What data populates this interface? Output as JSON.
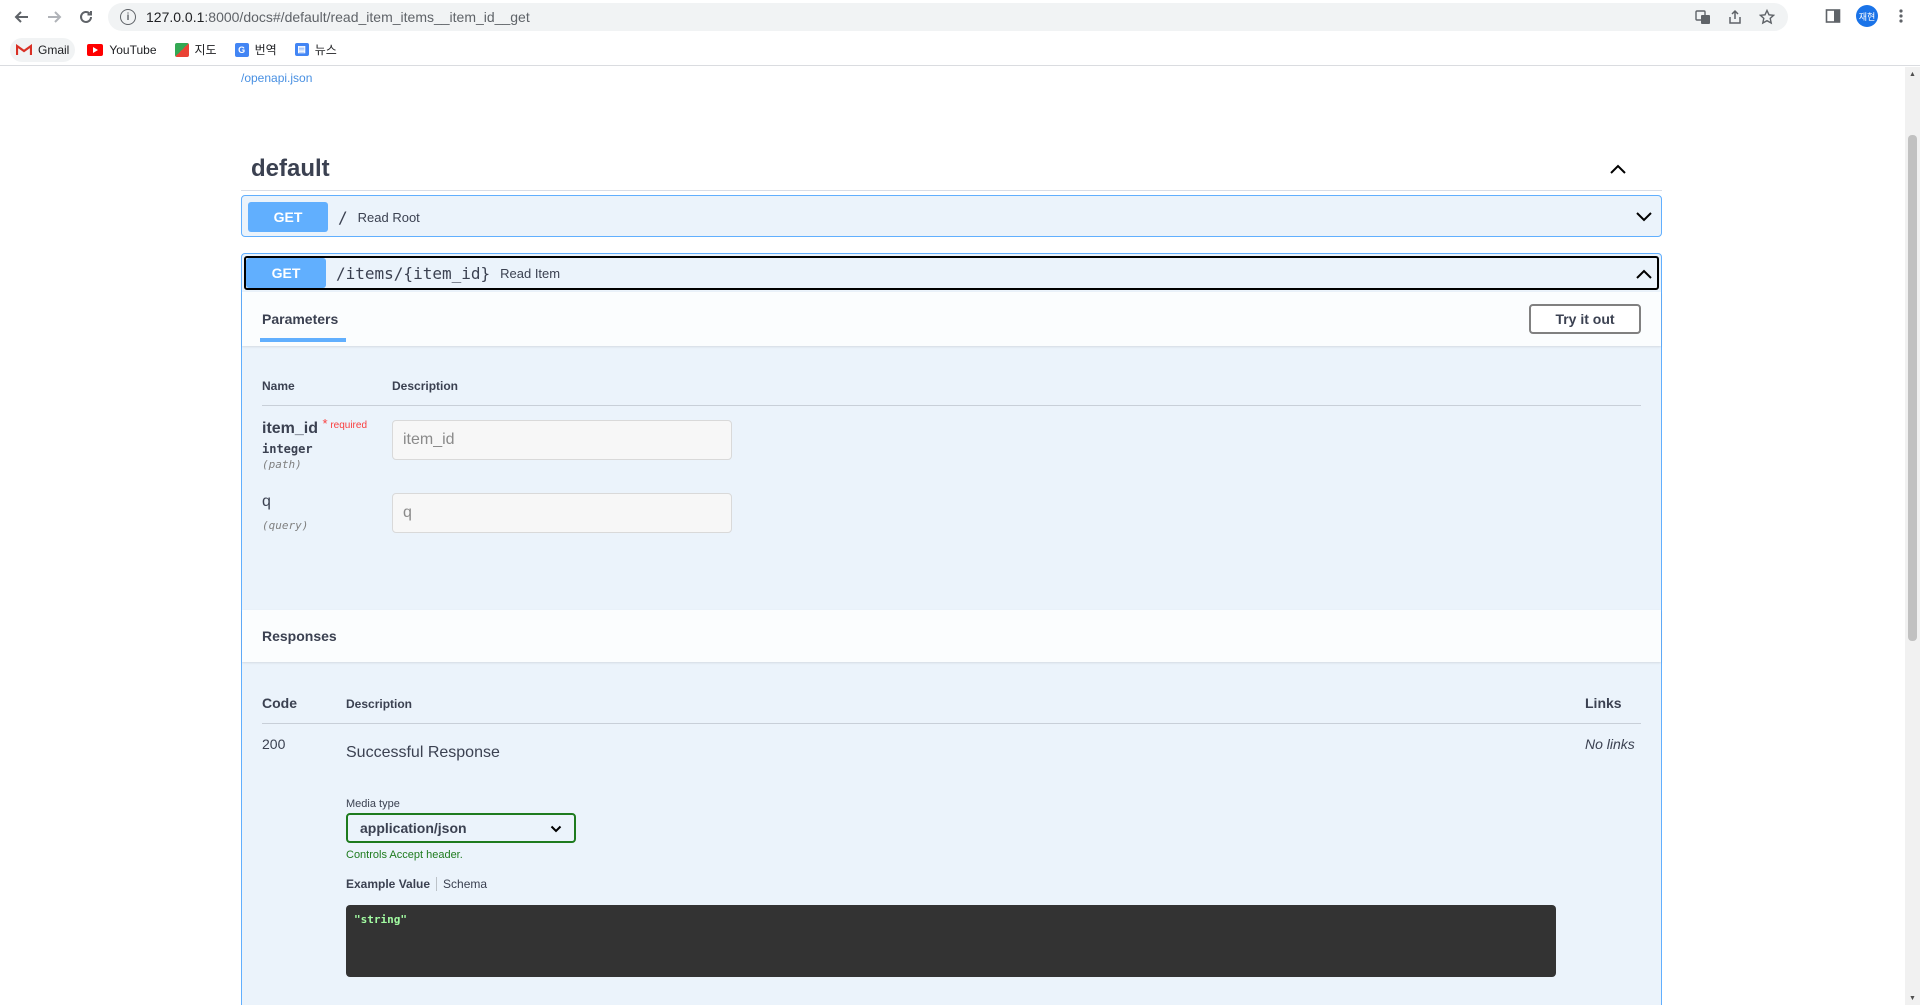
{
  "browser": {
    "url_host": "127.0.0.1",
    "url_path": ":8000/docs#/default/read_item_items__item_id__get",
    "profile_initials": "재현",
    "bookmarks": [
      {
        "label": "Gmail",
        "icon": "gmail-icon",
        "color": "#d93025"
      },
      {
        "label": "YouTube",
        "icon": "youtube-icon",
        "color": "#ff0000"
      },
      {
        "label": "지도",
        "icon": "maps-icon",
        "color": "#34a853"
      },
      {
        "label": "번역",
        "icon": "translate-icon",
        "color": "#4285f4"
      },
      {
        "label": "뉴스",
        "icon": "news-icon",
        "color": "#4285f4"
      }
    ]
  },
  "swagger": {
    "openapi_link": "/openapi.json",
    "tag": "default",
    "ops": [
      {
        "method": "GET",
        "path": "/",
        "summary": "Read Root",
        "expanded": false
      },
      {
        "method": "GET",
        "path": "/items/{item_id}",
        "summary": "Read Item",
        "expanded": true
      }
    ],
    "params_tab": "Parameters",
    "try_label": "Try it out",
    "param_cols": {
      "name": "Name",
      "description": "Description"
    },
    "params": [
      {
        "name": "item_id",
        "required_star": "*",
        "required_label": "required",
        "type": "integer",
        "in": "(path)",
        "placeholder": "item_id"
      },
      {
        "name": "q",
        "type": "",
        "in": "(query)",
        "placeholder": "q"
      }
    ],
    "responses_label": "Responses",
    "resp_cols": {
      "code": "Code",
      "description": "Description",
      "links": "Links"
    },
    "response": {
      "code": "200",
      "description": "Successful Response",
      "links": "No links",
      "media_type_label": "Media type",
      "media_type": "application/json",
      "controls_note": "Controls Accept header.",
      "example_tab": "Example Value",
      "schema_tab": "Schema",
      "example_value": "\"string\""
    }
  },
  "colors": {
    "get": "#61affe",
    "accent_green": "#1e7b1e"
  }
}
